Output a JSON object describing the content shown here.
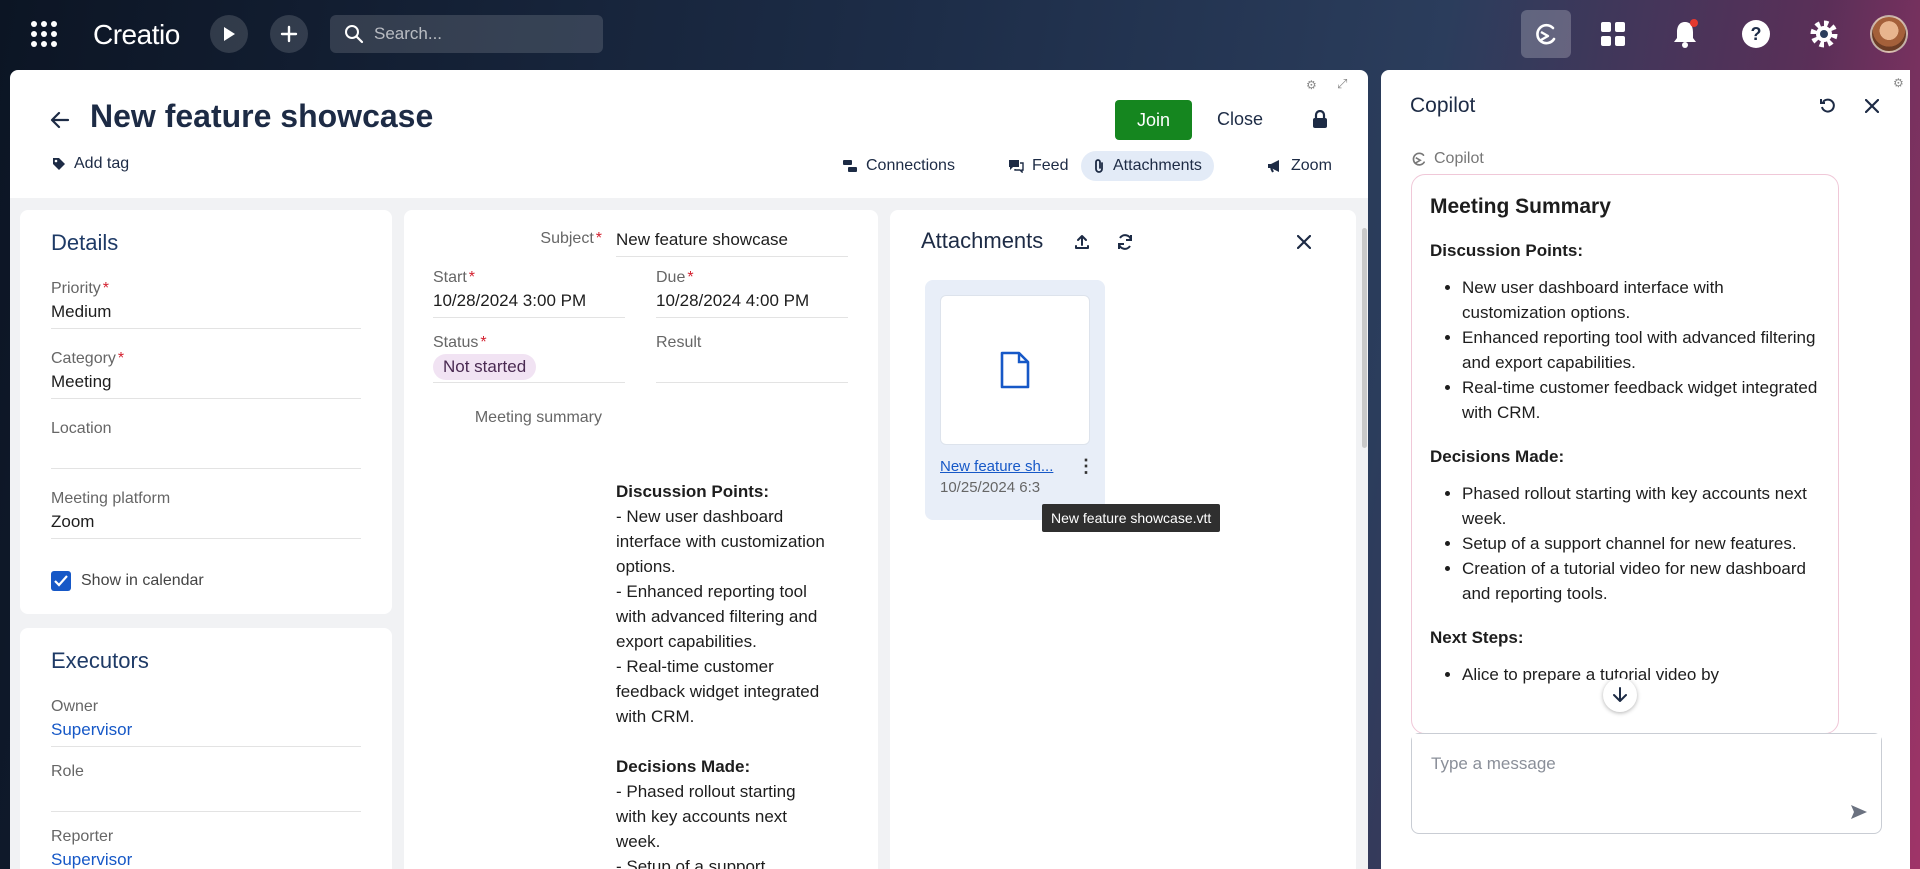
{
  "topbar": {
    "brand": "Creatio",
    "search_placeholder": "Search..."
  },
  "record": {
    "title": "New feature showcase",
    "add_tag": "Add tag",
    "join_label": "Join",
    "close_label": "Close",
    "tabs": [
      "Connections",
      "Feed",
      "Attachments",
      "Zoom"
    ]
  },
  "details": {
    "title": "Details",
    "priority_label": "Priority",
    "priority_value": "Medium",
    "category_label": "Category",
    "category_value": "Meeting",
    "location_label": "Location",
    "location_value": "",
    "platform_label": "Meeting platform",
    "platform_value": "Zoom",
    "calendar_label": "Show in calendar"
  },
  "executors": {
    "title": "Executors",
    "owner_label": "Owner",
    "owner_value": "Supervisor",
    "role_label": "Role",
    "reporter_label": "Reporter",
    "reporter_value": "Supervisor"
  },
  "form": {
    "subject_label": "Subject",
    "subject_value": "New feature showcase",
    "start_label": "Start",
    "start_value": "10/28/2024 3:00 PM",
    "due_label": "Due",
    "due_value": "10/28/2024 4:00 PM",
    "status_label": "Status",
    "status_value": "Not started",
    "result_label": "Result",
    "summary_label": "Meeting summary",
    "summary_h1": "Discussion Points:",
    "summary_l1": "- New user dashboard interface with customization options.",
    "summary_l2": "- Enhanced reporting tool with advanced filtering and export capabilities.",
    "summary_l3": "- Real-time customer feedback widget integrated with CRM.",
    "summary_h2": "Decisions Made:",
    "summary_l4": "- Phased rollout starting with key accounts next week.",
    "summary_l5": "- Setup of a support channel for new features."
  },
  "attachments": {
    "title": "Attachments",
    "file_name": "New feature sh...",
    "file_date": "10/25/2024 6:3",
    "tooltip": "New feature showcase.vtt"
  },
  "copilot": {
    "title": "Copilot",
    "source_label": "Copilot",
    "summary_title": "Meeting Summary",
    "h_discussion": "Discussion Points:",
    "discussion": [
      "New user dashboard interface with customization options.",
      "Enhanced reporting tool with advanced filtering and export capabilities.",
      "Real-time customer feedback widget integrated with CRM."
    ],
    "h_decisions": "Decisions Made:",
    "decisions": [
      "Phased rollout starting with key accounts next week.",
      "Setup of a support channel for new features.",
      "Creation of a tutorial video for new dashboard and reporting tools."
    ],
    "h_next": "Next Steps:",
    "next": [
      "Alice to prepare a tutorial video by"
    ],
    "message_placeholder": "Type a message"
  },
  "colors": {
    "join": "#15861f",
    "accent": "#1658c7",
    "title": "#1d2b45"
  }
}
